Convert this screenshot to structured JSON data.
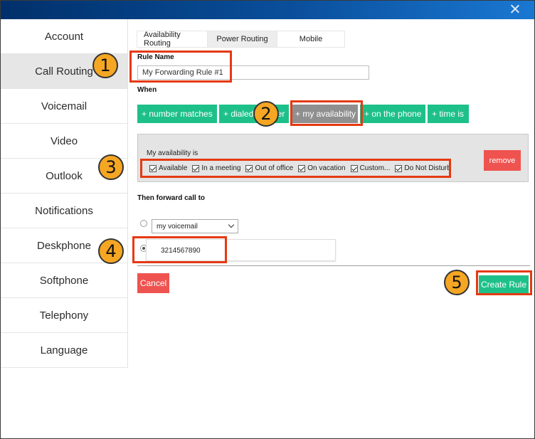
{
  "window": {
    "close_icon": "close-icon",
    "titlebar_colors": [
      "#00306b",
      "#1a78d2"
    ]
  },
  "sidebar": {
    "items": [
      {
        "label": "Account"
      },
      {
        "label": "Call Routing"
      },
      {
        "label": "Voicemail"
      },
      {
        "label": "Video"
      },
      {
        "label": "Outlook"
      },
      {
        "label": "Notifications"
      },
      {
        "label": "Deskphone"
      },
      {
        "label": "Softphone"
      },
      {
        "label": "Telephony"
      },
      {
        "label": "Language"
      }
    ],
    "active": "Call Routing"
  },
  "tabs": [
    {
      "label": "Availability Routing"
    },
    {
      "label": "Power Routing"
    },
    {
      "label": "Mobile"
    }
  ],
  "rule_name": {
    "label": "Rule Name",
    "value": "My Forwarding Rule #1"
  },
  "when": {
    "label": "When",
    "conditions": [
      {
        "label": "+ number matches"
      },
      {
        "label": "+ dialed number"
      },
      {
        "label": "+ my availability"
      },
      {
        "label": "+ on the phone"
      },
      {
        "label": "+ time is"
      }
    ]
  },
  "availability": {
    "title": "My availability is",
    "options": [
      {
        "label": "Available",
        "checked": true
      },
      {
        "label": "In a meeting",
        "checked": true
      },
      {
        "label": "Out of office",
        "checked": true
      },
      {
        "label": "On vacation",
        "checked": true
      },
      {
        "label": "Custom...",
        "checked": true
      },
      {
        "label": "Do Not Disturb",
        "checked": true
      }
    ],
    "remove_label": "remove"
  },
  "forward": {
    "label": "Then forward call to",
    "voicemail_option": "my voicemail",
    "phone_number": "3214567890"
  },
  "actions": {
    "cancel_label": "Cancel",
    "create_label": "Create Rule"
  },
  "callouts": [
    "1",
    "2",
    "3",
    "4",
    "5"
  ],
  "colors": {
    "accent_green": "#1ec08a",
    "danger_red": "#ef5350",
    "highlight_red": "#e53912",
    "callout_orange": "#f5a623"
  }
}
